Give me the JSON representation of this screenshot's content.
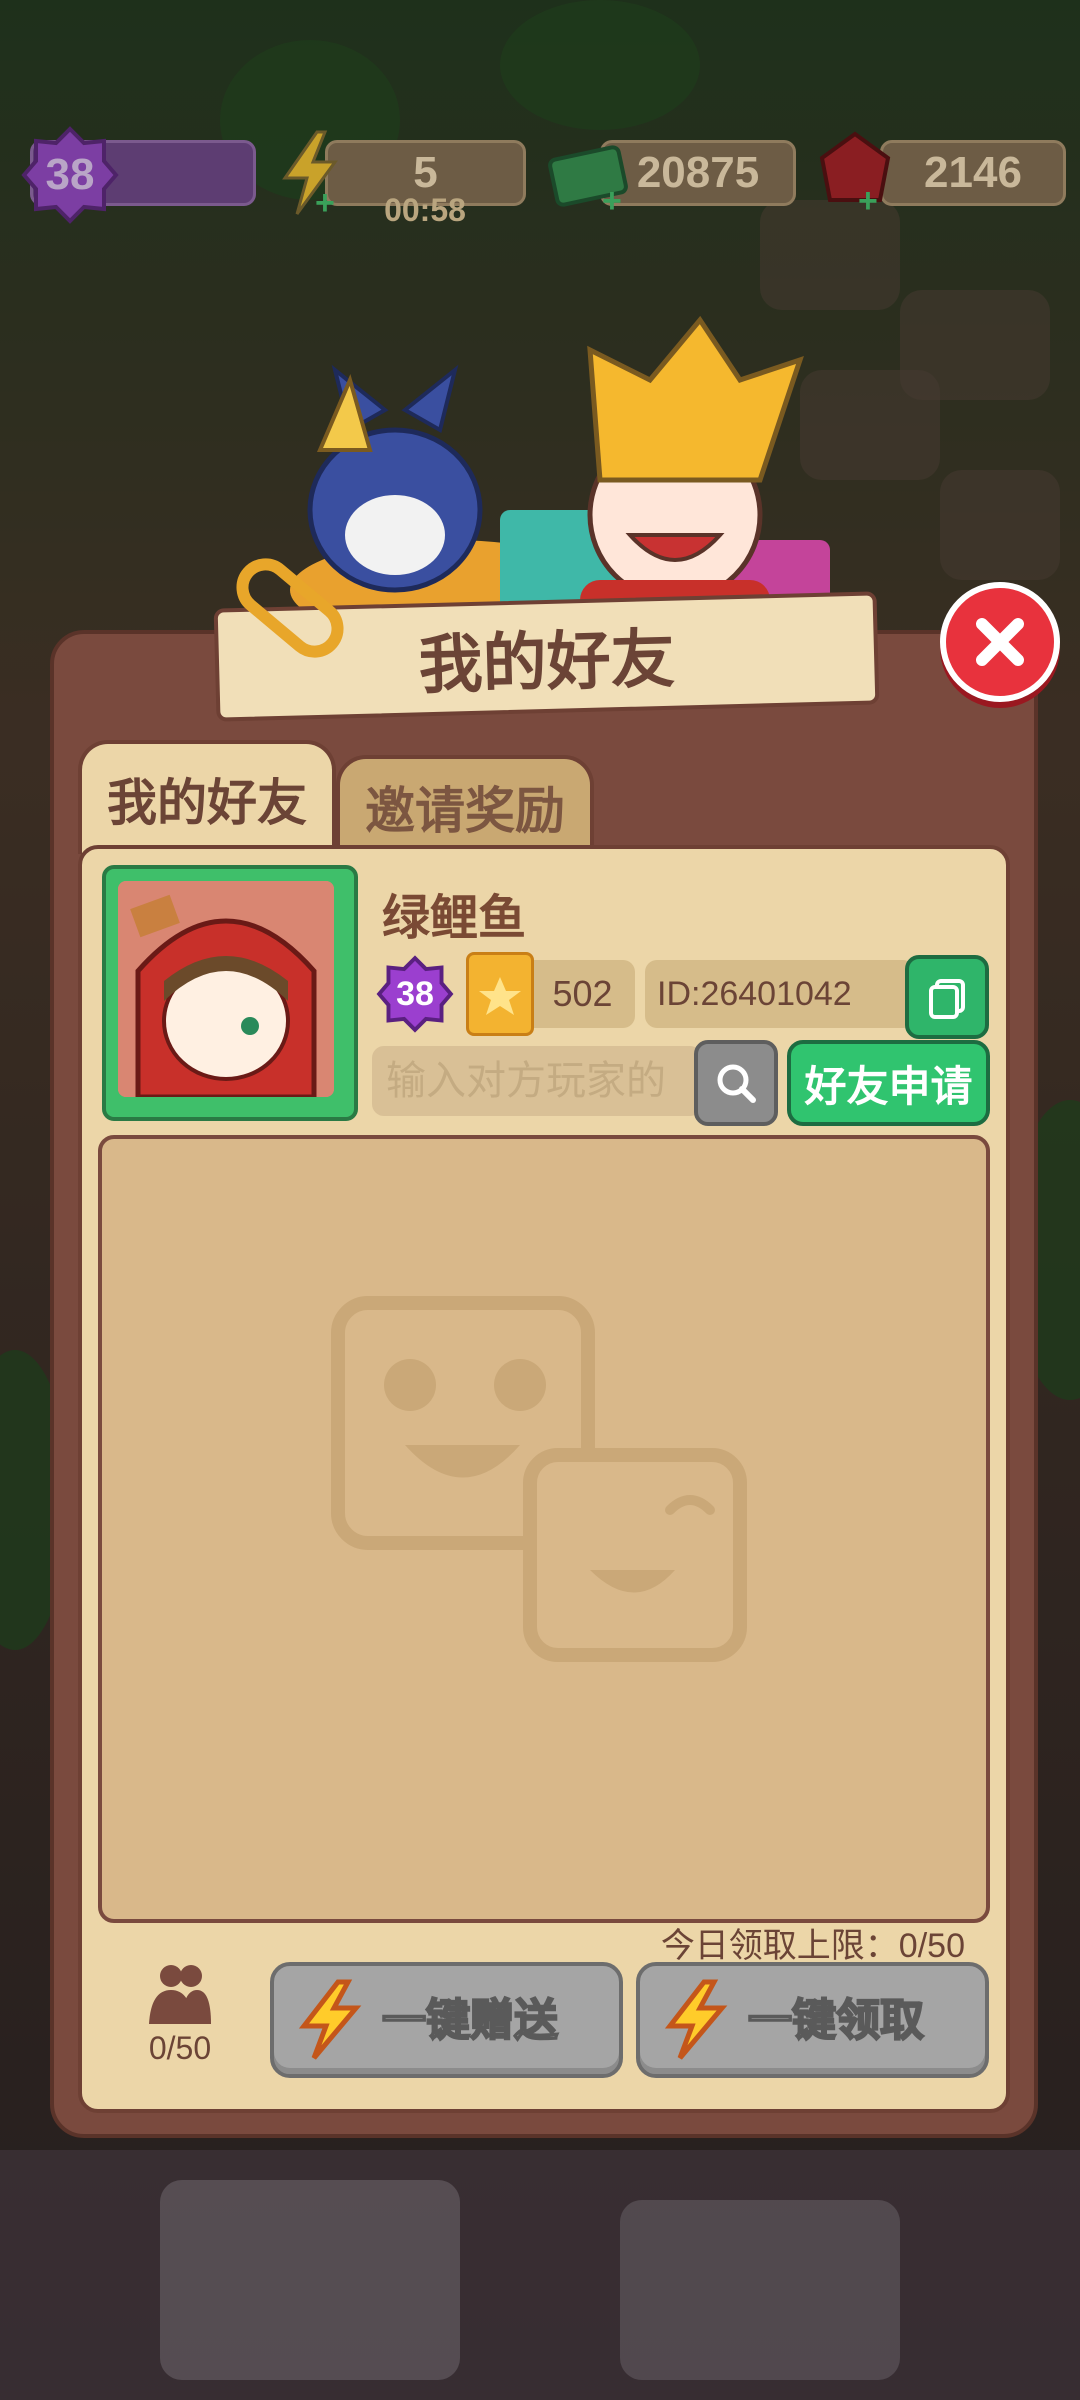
{
  "top_bar": {
    "level": "38",
    "energy": "5",
    "energy_timer": "00:58",
    "cash": "20875",
    "gems": "2146"
  },
  "panel": {
    "title": "我的好友",
    "tabs": [
      {
        "label": "我的好友",
        "active": true
      },
      {
        "label": "邀请奖励",
        "active": false
      }
    ]
  },
  "profile": {
    "nickname": "绿鲤鱼",
    "level": "38",
    "score": "502",
    "id": "ID:26401042"
  },
  "search": {
    "placeholder": "输入对方玩家的",
    "apply_label": "好友申请"
  },
  "bottom": {
    "daily_limit": "今日领取上限：0/50",
    "friend_count": "0/50",
    "gift_all_label": "一键赠送",
    "claim_all_label": "一键领取"
  },
  "colors": {
    "panel": "#7a4a3e",
    "panel_inner": "#ecd6a8",
    "accent_green": "#30c46f",
    "close_red": "#e8323d",
    "disabled_gray": "#a5a5a5"
  },
  "icons": [
    "level-badge-icon",
    "energy-icon",
    "cash-icon",
    "gem-icon",
    "close-icon",
    "star-clipboard-icon",
    "copy-icon",
    "search-icon",
    "friends-icon",
    "lightning-icon",
    "empty-smiley-icon"
  ]
}
